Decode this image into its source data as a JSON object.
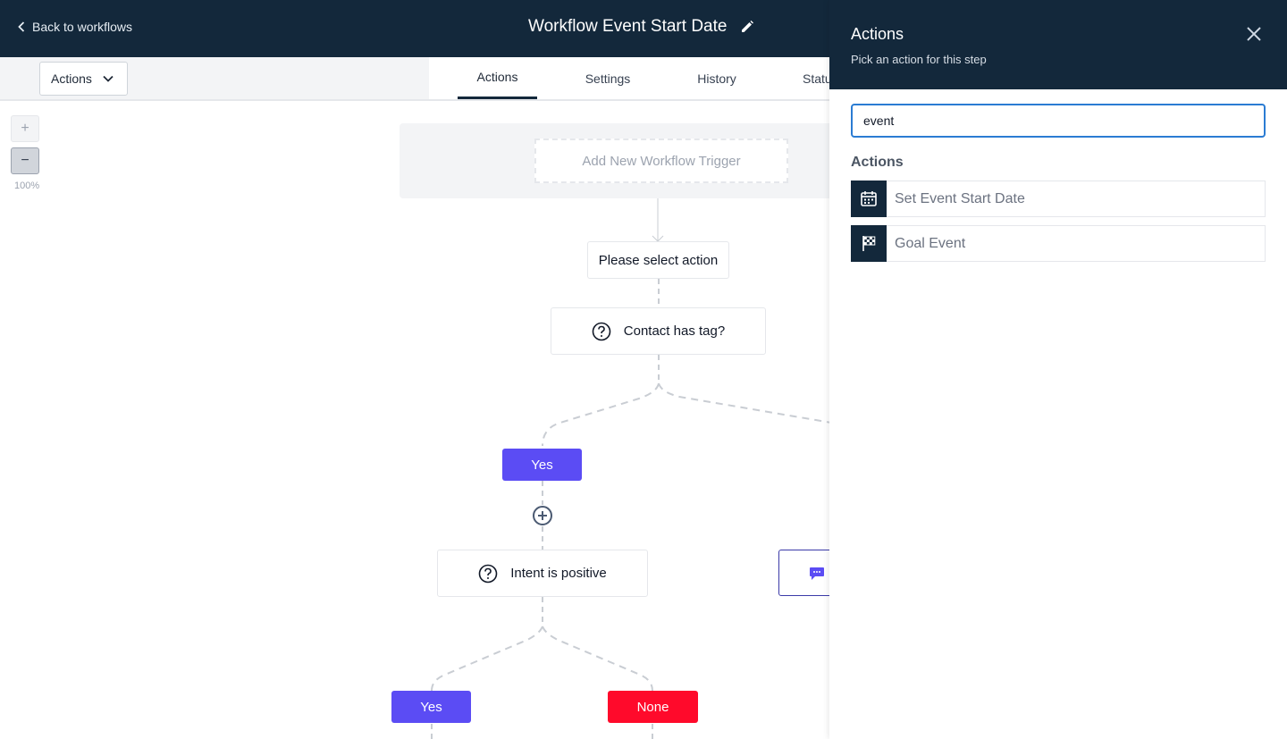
{
  "header": {
    "back_label": "Back to workflows",
    "title": "Workflow Event Start Date"
  },
  "toolbar": {
    "actions_dropdown": "Actions",
    "tabs": [
      {
        "label": "Actions",
        "active": true
      },
      {
        "label": "Settings",
        "active": false
      },
      {
        "label": "History",
        "active": false
      },
      {
        "label": "Status",
        "active": false
      }
    ]
  },
  "canvas": {
    "zoom_in": "+",
    "zoom_out": "−",
    "zoom_level": "100%",
    "trigger_placeholder": "Add New Workflow Trigger",
    "nodes": {
      "select_action": "Please select action",
      "contact_has_tag": "Contact has tag?",
      "intent_positive": "Intent is positive"
    },
    "branches": {
      "yes_1": "Yes",
      "yes_2": "Yes",
      "none": "None"
    },
    "colors": {
      "yes": "#5b4cf4",
      "none": "#ff0a2b",
      "header": "#13283b"
    }
  },
  "panel": {
    "title": "Actions",
    "subtitle": "Pick an action for this step",
    "search_value": "event",
    "section_label": "Actions",
    "items": [
      {
        "label": "Set Event Start Date",
        "icon": "calendar-icon"
      },
      {
        "label": "Goal Event",
        "icon": "checkered-flag-icon"
      }
    ]
  }
}
